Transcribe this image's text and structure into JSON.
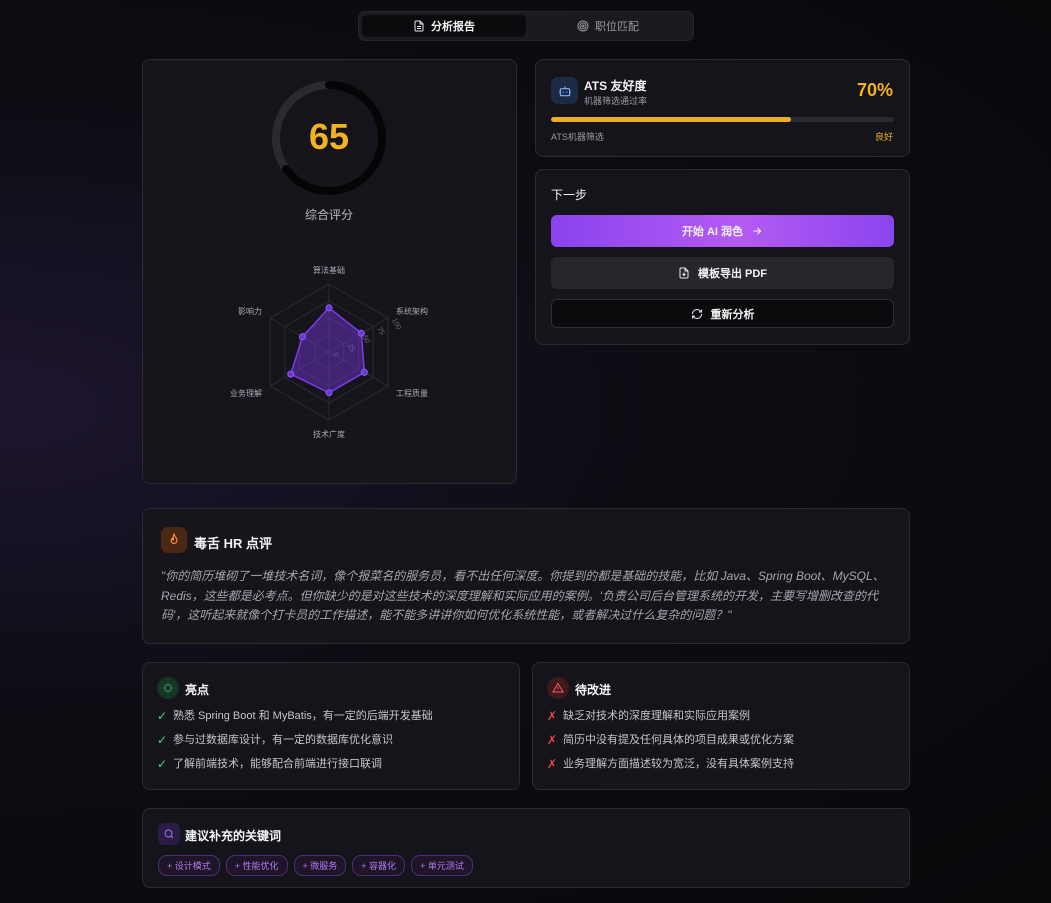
{
  "tabs": [
    {
      "label": "分析报告",
      "icon": "file-text-icon",
      "active": true
    },
    {
      "label": "职位匹配",
      "icon": "target-icon",
      "active": false
    }
  ],
  "score": {
    "value": "65",
    "label": "综合评分",
    "fraction": 0.65,
    "color": "#f2b221"
  },
  "radar": {
    "axes": [
      "算法基础",
      "系统架构",
      "工程质量",
      "技术广度",
      "业务理解",
      "影响力"
    ],
    "values": [
      65,
      55,
      60,
      60,
      65,
      45
    ],
    "max": 100,
    "ticks": [
      "0",
      "25",
      "50",
      "75",
      "100"
    ],
    "color": "#7c3aed"
  },
  "ats": {
    "title": "ATS 友好度",
    "subtitle": "机器筛选通过率",
    "percent": "70%",
    "fraction": 0.7,
    "left_label": "ATS机器筛选",
    "right_label": "良好"
  },
  "next_steps": {
    "title": "下一步",
    "primary_label": "开始 AI 润色",
    "export_label": "模板导出 PDF",
    "reanalyze_label": "重新分析"
  },
  "hr_review": {
    "title": "毒舌 HR 点评",
    "text": "\"你的简历堆砌了一堆技术名词，像个报菜名的服务员，看不出任何深度。你提到的都是基础的技能，比如 Java、Spring Boot、MySQL、Redis，这些都是必考点。但你缺少的是对这些技术的深度理解和实际应用的案例。'负责公司后台管理系统的开发，主要写增删改查的代码'，这听起来就像个打卡员的工作描述，能不能多讲讲你如何优化系统性能，或者解决过什么复杂的问题？\""
  },
  "highlights": {
    "title": "亮点",
    "items": [
      "熟悉 Spring Boot 和 MyBatis，有一定的后端开发基础",
      "参与过数据库设计，有一定的数据库优化意识",
      "了解前端技术，能够配合前端进行接口联调"
    ]
  },
  "improvements": {
    "title": "待改进",
    "items": [
      "缺乏对技术的深度理解和实际应用案例",
      "简历中没有提及任何具体的项目成果或优化方案",
      "业务理解方面描述较为宽泛，没有具体案例支持"
    ]
  },
  "keywords": {
    "title": "建议补充的关键词",
    "items": [
      "+ 设计模式",
      "+ 性能优化",
      "+ 微服务",
      "+ 容器化",
      "+ 单元测试"
    ]
  }
}
